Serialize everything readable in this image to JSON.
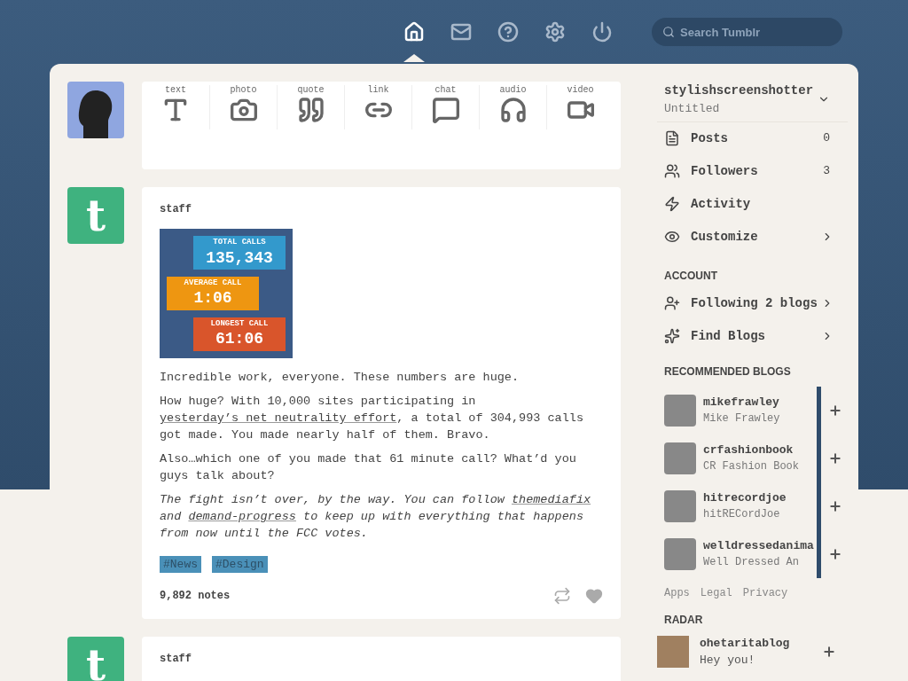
{
  "nav": {
    "icons": [
      {
        "kind": "home",
        "selected": true
      },
      {
        "kind": "mail",
        "selected": false
      },
      {
        "kind": "help",
        "selected": false
      },
      {
        "kind": "settings",
        "selected": false
      },
      {
        "kind": "power",
        "selected": false
      }
    ],
    "search": {
      "placeholder": "Search Tumblr"
    }
  },
  "composer": {
    "types": [
      {
        "label": "text",
        "kind": "text"
      },
      {
        "label": "photo",
        "kind": "photo"
      },
      {
        "label": "quote",
        "kind": "quote"
      },
      {
        "label": "link",
        "kind": "link"
      },
      {
        "label": "chat",
        "kind": "chat"
      },
      {
        "label": "audio",
        "kind": "audio"
      },
      {
        "label": "video",
        "kind": "video"
      }
    ]
  },
  "posts": [
    {
      "author": "staff",
      "avatar_letter": "t",
      "image": {
        "stats": [
          {
            "label": "TOTAL CALLS",
            "value": "135,343",
            "color": "#3399cc"
          },
          {
            "label": "AVERAGE CALL",
            "value": "1:06",
            "color": "#ee9611"
          },
          {
            "label": "LONGEST CALL",
            "value": "61:06",
            "color": "#d9552b"
          }
        ]
      },
      "paragraphs": [
        {
          "kind": "plain",
          "parts": [
            {
              "kind": "text",
              "text": "Incredible work, everyone. These numbers are huge."
            }
          ]
        },
        {
          "kind": "plain",
          "parts": [
            {
              "kind": "text",
              "text": "How huge? With 10,000 sites participating in "
            },
            {
              "kind": "link",
              "text": "yesterday’s net neutrality effort"
            },
            {
              "kind": "text",
              "text": ", a total of 304,993 calls got made. You made nearly half of them. Bravo."
            }
          ]
        },
        {
          "kind": "plain",
          "parts": [
            {
              "kind": "text",
              "text": "Also…which one of you made that 61 minute call? What’d you guys talk about?"
            }
          ]
        },
        {
          "kind": "italic",
          "parts": [
            {
              "kind": "text",
              "text": "The fight isn’t over, by the way. You can follow "
            },
            {
              "kind": "link",
              "text": "themediafix"
            },
            {
              "kind": "text",
              "text": " and "
            },
            {
              "kind": "link",
              "text": "demand-progress"
            },
            {
              "kind": "text",
              "text": " to keep up with everything that happens from now until the FCC votes."
            }
          ]
        }
      ],
      "tags": [
        "#News",
        "#Design"
      ],
      "notes": "9,892 notes"
    },
    {
      "author": "staff",
      "avatar_letter": "t"
    }
  ],
  "sidebar": {
    "blog": {
      "name": "stylishscreenshotter",
      "title": "Untitled"
    },
    "items": [
      {
        "kind": "posts",
        "label": "Posts",
        "count": "0",
        "arrow": false
      },
      {
        "kind": "followers",
        "label": "Followers",
        "count": "3",
        "arrow": false
      },
      {
        "kind": "activity",
        "label": "Activity",
        "arrow": false
      },
      {
        "kind": "customize",
        "label": "Customize",
        "arrow": true
      }
    ],
    "account_heading": "ACCOUNT",
    "account_items": [
      {
        "kind": "following",
        "label": "Following 2 blogs",
        "arrow": true
      },
      {
        "kind": "find",
        "label": "Find Blogs",
        "arrow": true
      }
    ],
    "recommended_heading": "RECOMMENDED BLOGS",
    "recommended": [
      {
        "name": "mikefrawley",
        "title": "Mike Frawley"
      },
      {
        "name": "crfashionbook",
        "title": "CR Fashion Book"
      },
      {
        "name": "hitrecordjoe",
        "title": "hitRECordJoe"
      },
      {
        "name": "welldressedanima",
        "title": "Well Dressed An"
      }
    ],
    "footer_links": [
      "Apps",
      "Legal",
      "Privacy"
    ],
    "radar_heading": "RADAR",
    "radar": {
      "name": "ohetaritablog",
      "title": "Hey you!"
    }
  }
}
